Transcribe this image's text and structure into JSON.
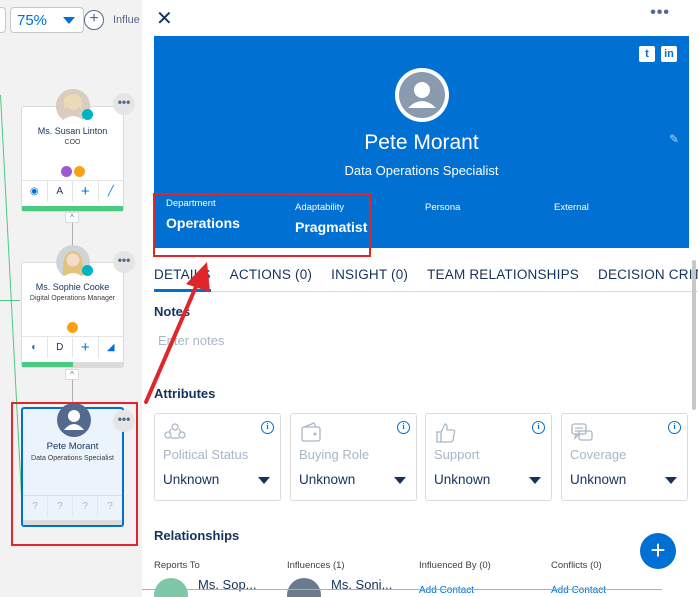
{
  "toolbar": {
    "zoom_value": "75%",
    "influence_label": "Influe"
  },
  "cards": [
    {
      "name": "Ms. Susan Linton",
      "title": "COO",
      "tool_letter": "A"
    },
    {
      "name": "Ms. Sophie Cooke",
      "title": "Digital Operations Manager",
      "tool_letter": "D"
    },
    {
      "name": "Pete Morant",
      "title": "Data Operations Specialist",
      "tool_q": [
        "?",
        "?",
        "?",
        "?"
      ]
    }
  ],
  "chevron": "^",
  "more_glyph": "•••",
  "panel": {
    "close": "✕",
    "more": "•••",
    "contact": {
      "name": "Pete Morant",
      "role": "Data Operations Specialist",
      "department_label": "Department",
      "department_value": "Operations",
      "adaptability_label": "Adaptability",
      "adaptability_value": "Pragmatist",
      "persona_label": "Persona",
      "external_label": "External",
      "social": [
        "t",
        "in"
      ]
    },
    "tabs": [
      {
        "label": "DETAILS"
      },
      {
        "label": "ACTIONS (0)"
      },
      {
        "label": "INSIGHT (0)"
      },
      {
        "label": "TEAM RELATIONSHIPS"
      },
      {
        "label": "DECISION CRITERIA"
      }
    ],
    "notes": {
      "title": "Notes",
      "placeholder": "Enter notes"
    },
    "attributes": {
      "title": "Attributes",
      "items": [
        {
          "name": "Political Status",
          "value": "Unknown",
          "icon": "people-network-icon"
        },
        {
          "name": "Buying Role",
          "value": "Unknown",
          "icon": "wallet-icon"
        },
        {
          "name": "Support",
          "value": "Unknown",
          "icon": "thumbs-up-icon"
        },
        {
          "name": "Coverage",
          "value": "Unknown",
          "icon": "chat-bubbles-icon"
        }
      ]
    },
    "relationships": {
      "title": "Relationships",
      "columns": [
        {
          "label": "Reports To",
          "person": "Ms. Sop..."
        },
        {
          "label": "Influences (1)",
          "person": "Ms. Soni..."
        },
        {
          "label": "Influenced By (0)",
          "action": "Add Contact"
        },
        {
          "label": "Conflicts (0)",
          "action": "Add Contact"
        }
      ]
    },
    "fab": "+"
  },
  "colors": {
    "brand_blue": "#0070d2",
    "highlight_red": "#e0252b",
    "progress_green": "#4bca81"
  },
  "progress": {
    "susan": 1.0,
    "sophie": 0.5,
    "pete": 0.0
  }
}
